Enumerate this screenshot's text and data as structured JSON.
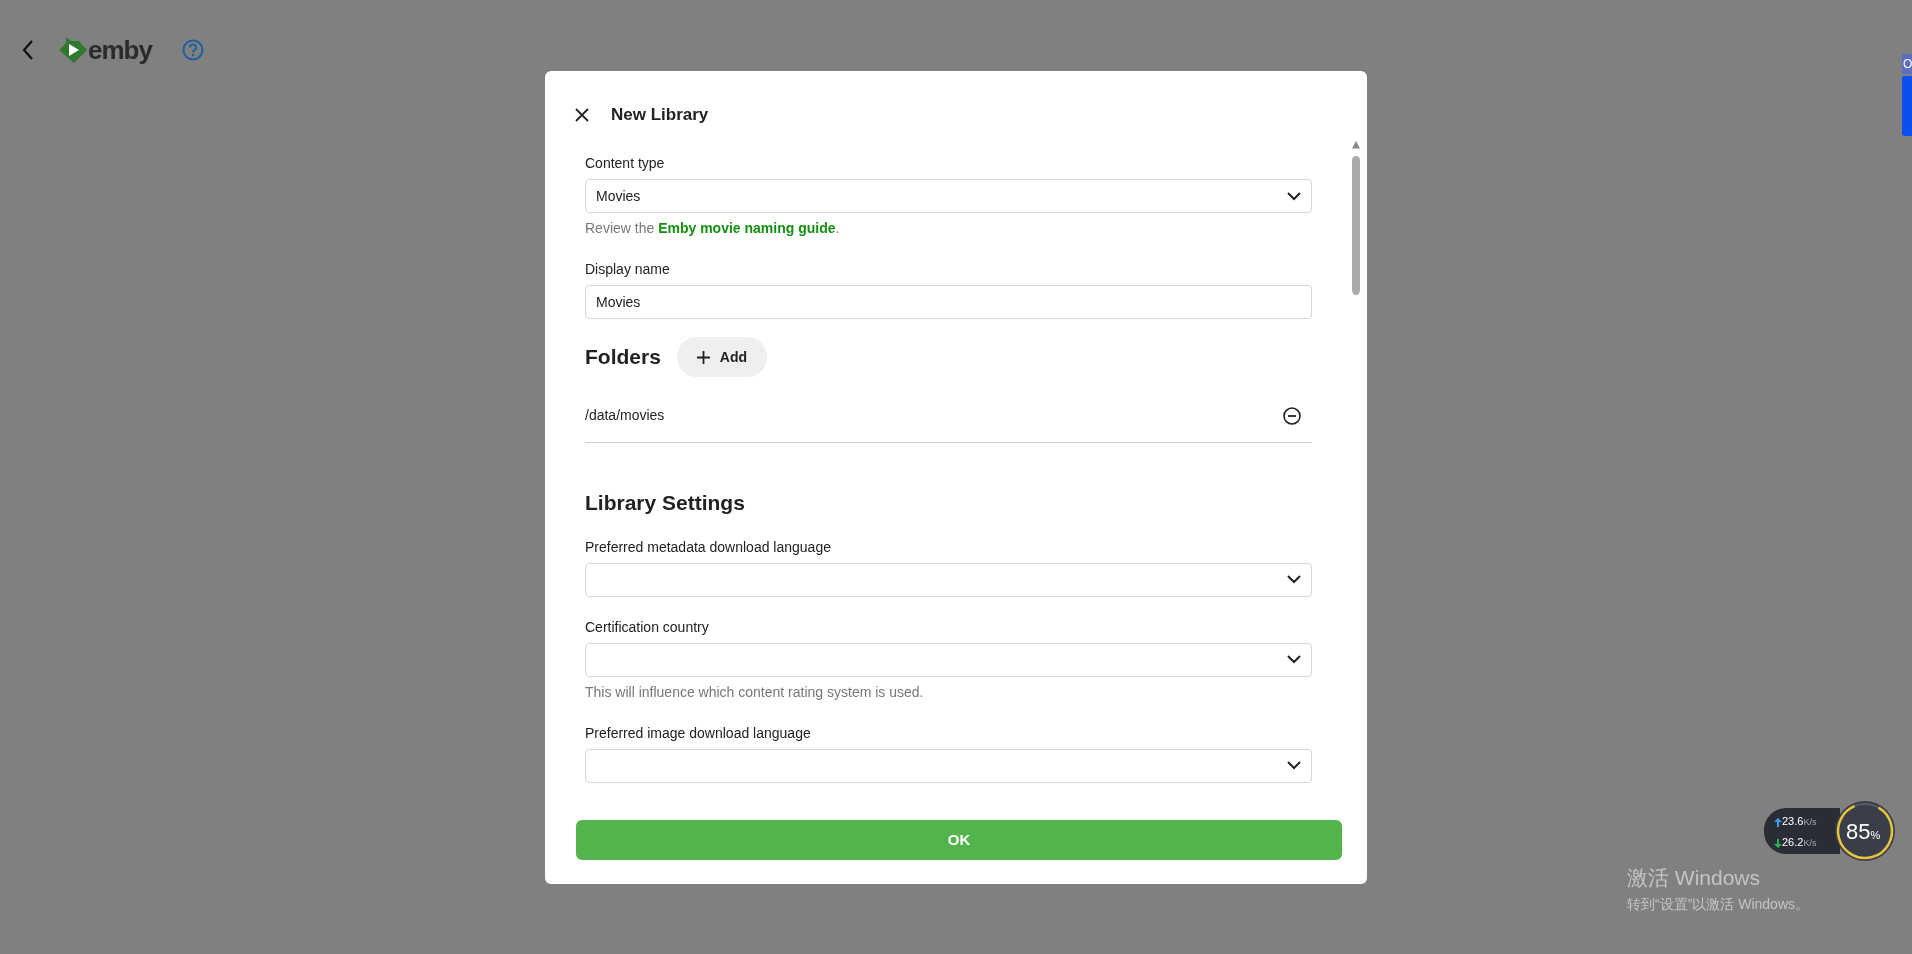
{
  "topbar": {
    "logo_text": "emby"
  },
  "side_tab": {
    "label": "O"
  },
  "dialog": {
    "title": "New Library",
    "fields": [
      {
        "kind": "select",
        "label": "Content type",
        "value": "Movies",
        "help": {
          "prefix": "Review the ",
          "link": "Emby movie naming guide",
          "suffix": "."
        }
      },
      {
        "kind": "input",
        "label": "Display name",
        "value": "Movies"
      }
    ],
    "folders": {
      "heading": "Folders",
      "add_label": "Add",
      "items": [
        {
          "path": "/data/movies"
        }
      ]
    },
    "settings": {
      "heading": "Library Settings",
      "fields": [
        {
          "kind": "select",
          "label": "Preferred metadata download language"
        },
        {
          "kind": "select",
          "label": "Certification country",
          "help_text": "This will influence which content rating system is used."
        },
        {
          "kind": "select",
          "label": "Preferred image download language"
        }
      ]
    },
    "ok_label": "OK"
  },
  "net_meter": {
    "upload": "23.6",
    "upload_unit": "K/s",
    "download": "26.2",
    "download_unit": "K/s",
    "percent": "85",
    "percent_sign": "%"
  },
  "activation": {
    "title": "激活 Windows",
    "subtitle": "转到“设置”以激活 Windows。"
  }
}
